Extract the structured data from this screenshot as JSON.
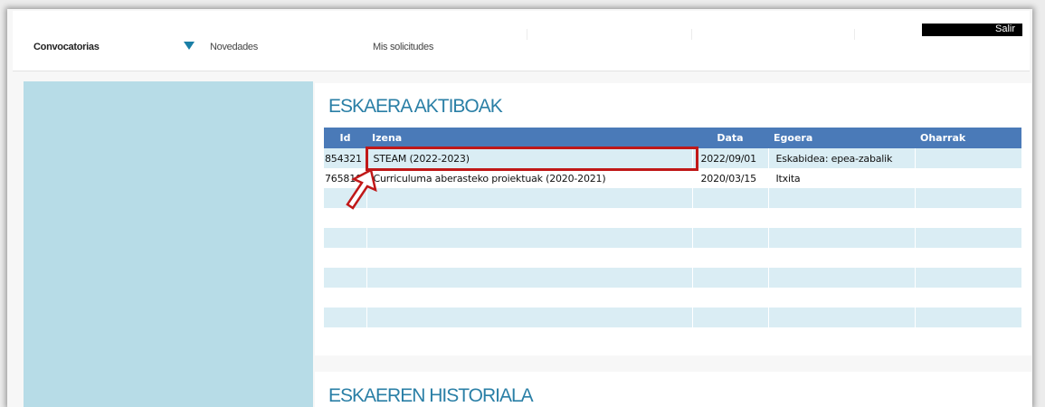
{
  "nav": {
    "convocatorias": "Convocatorias",
    "novedades": "Novedades",
    "mis_solicitudes": "Mis solicitudes",
    "salir": "Salir"
  },
  "sections": {
    "active_title": "ESKAERA AKTIBOAK",
    "history_title": "ESKAEREN HISTORIALA"
  },
  "table": {
    "headers": {
      "id": "Id",
      "izena": "Izena",
      "data": "Data",
      "egoera": "Egoera",
      "oharrak": "Oharrak"
    },
    "rows": [
      {
        "id": "854321",
        "izena": "STEAM (2022-2023)",
        "data": "2022/09/01",
        "egoera": "Eskabidea: epea-zabalik",
        "oharrak": ""
      },
      {
        "id": "765810",
        "izena": "Curriculuma aberasteko proiektuak (2020-2021)",
        "data": "2020/03/15",
        "egoera": "Itxita",
        "oharrak": ""
      },
      {
        "id": "",
        "izena": "",
        "data": "",
        "egoera": "",
        "oharrak": ""
      },
      {
        "id": "",
        "izena": "",
        "data": "",
        "egoera": "",
        "oharrak": ""
      },
      {
        "id": "",
        "izena": "",
        "data": "",
        "egoera": "",
        "oharrak": ""
      },
      {
        "id": "",
        "izena": "",
        "data": "",
        "egoera": "",
        "oharrak": ""
      },
      {
        "id": "",
        "izena": "",
        "data": "",
        "egoera": "",
        "oharrak": ""
      },
      {
        "id": "",
        "izena": "",
        "data": "",
        "egoera": "",
        "oharrak": ""
      },
      {
        "id": "",
        "izena": "",
        "data": "",
        "egoera": "",
        "oharrak": ""
      },
      {
        "id": "",
        "izena": "",
        "data": "",
        "egoera": "",
        "oharrak": ""
      }
    ]
  },
  "icons": {
    "dropdown": "triangle-down-icon",
    "annotation": "pointer-arrow-icon"
  },
  "colors": {
    "accent": "#2a7fa6",
    "table_header": "#4a7ab8",
    "row_alt": "#daedf4",
    "side_panel": "#b7dce7",
    "highlight": "#c01818"
  }
}
